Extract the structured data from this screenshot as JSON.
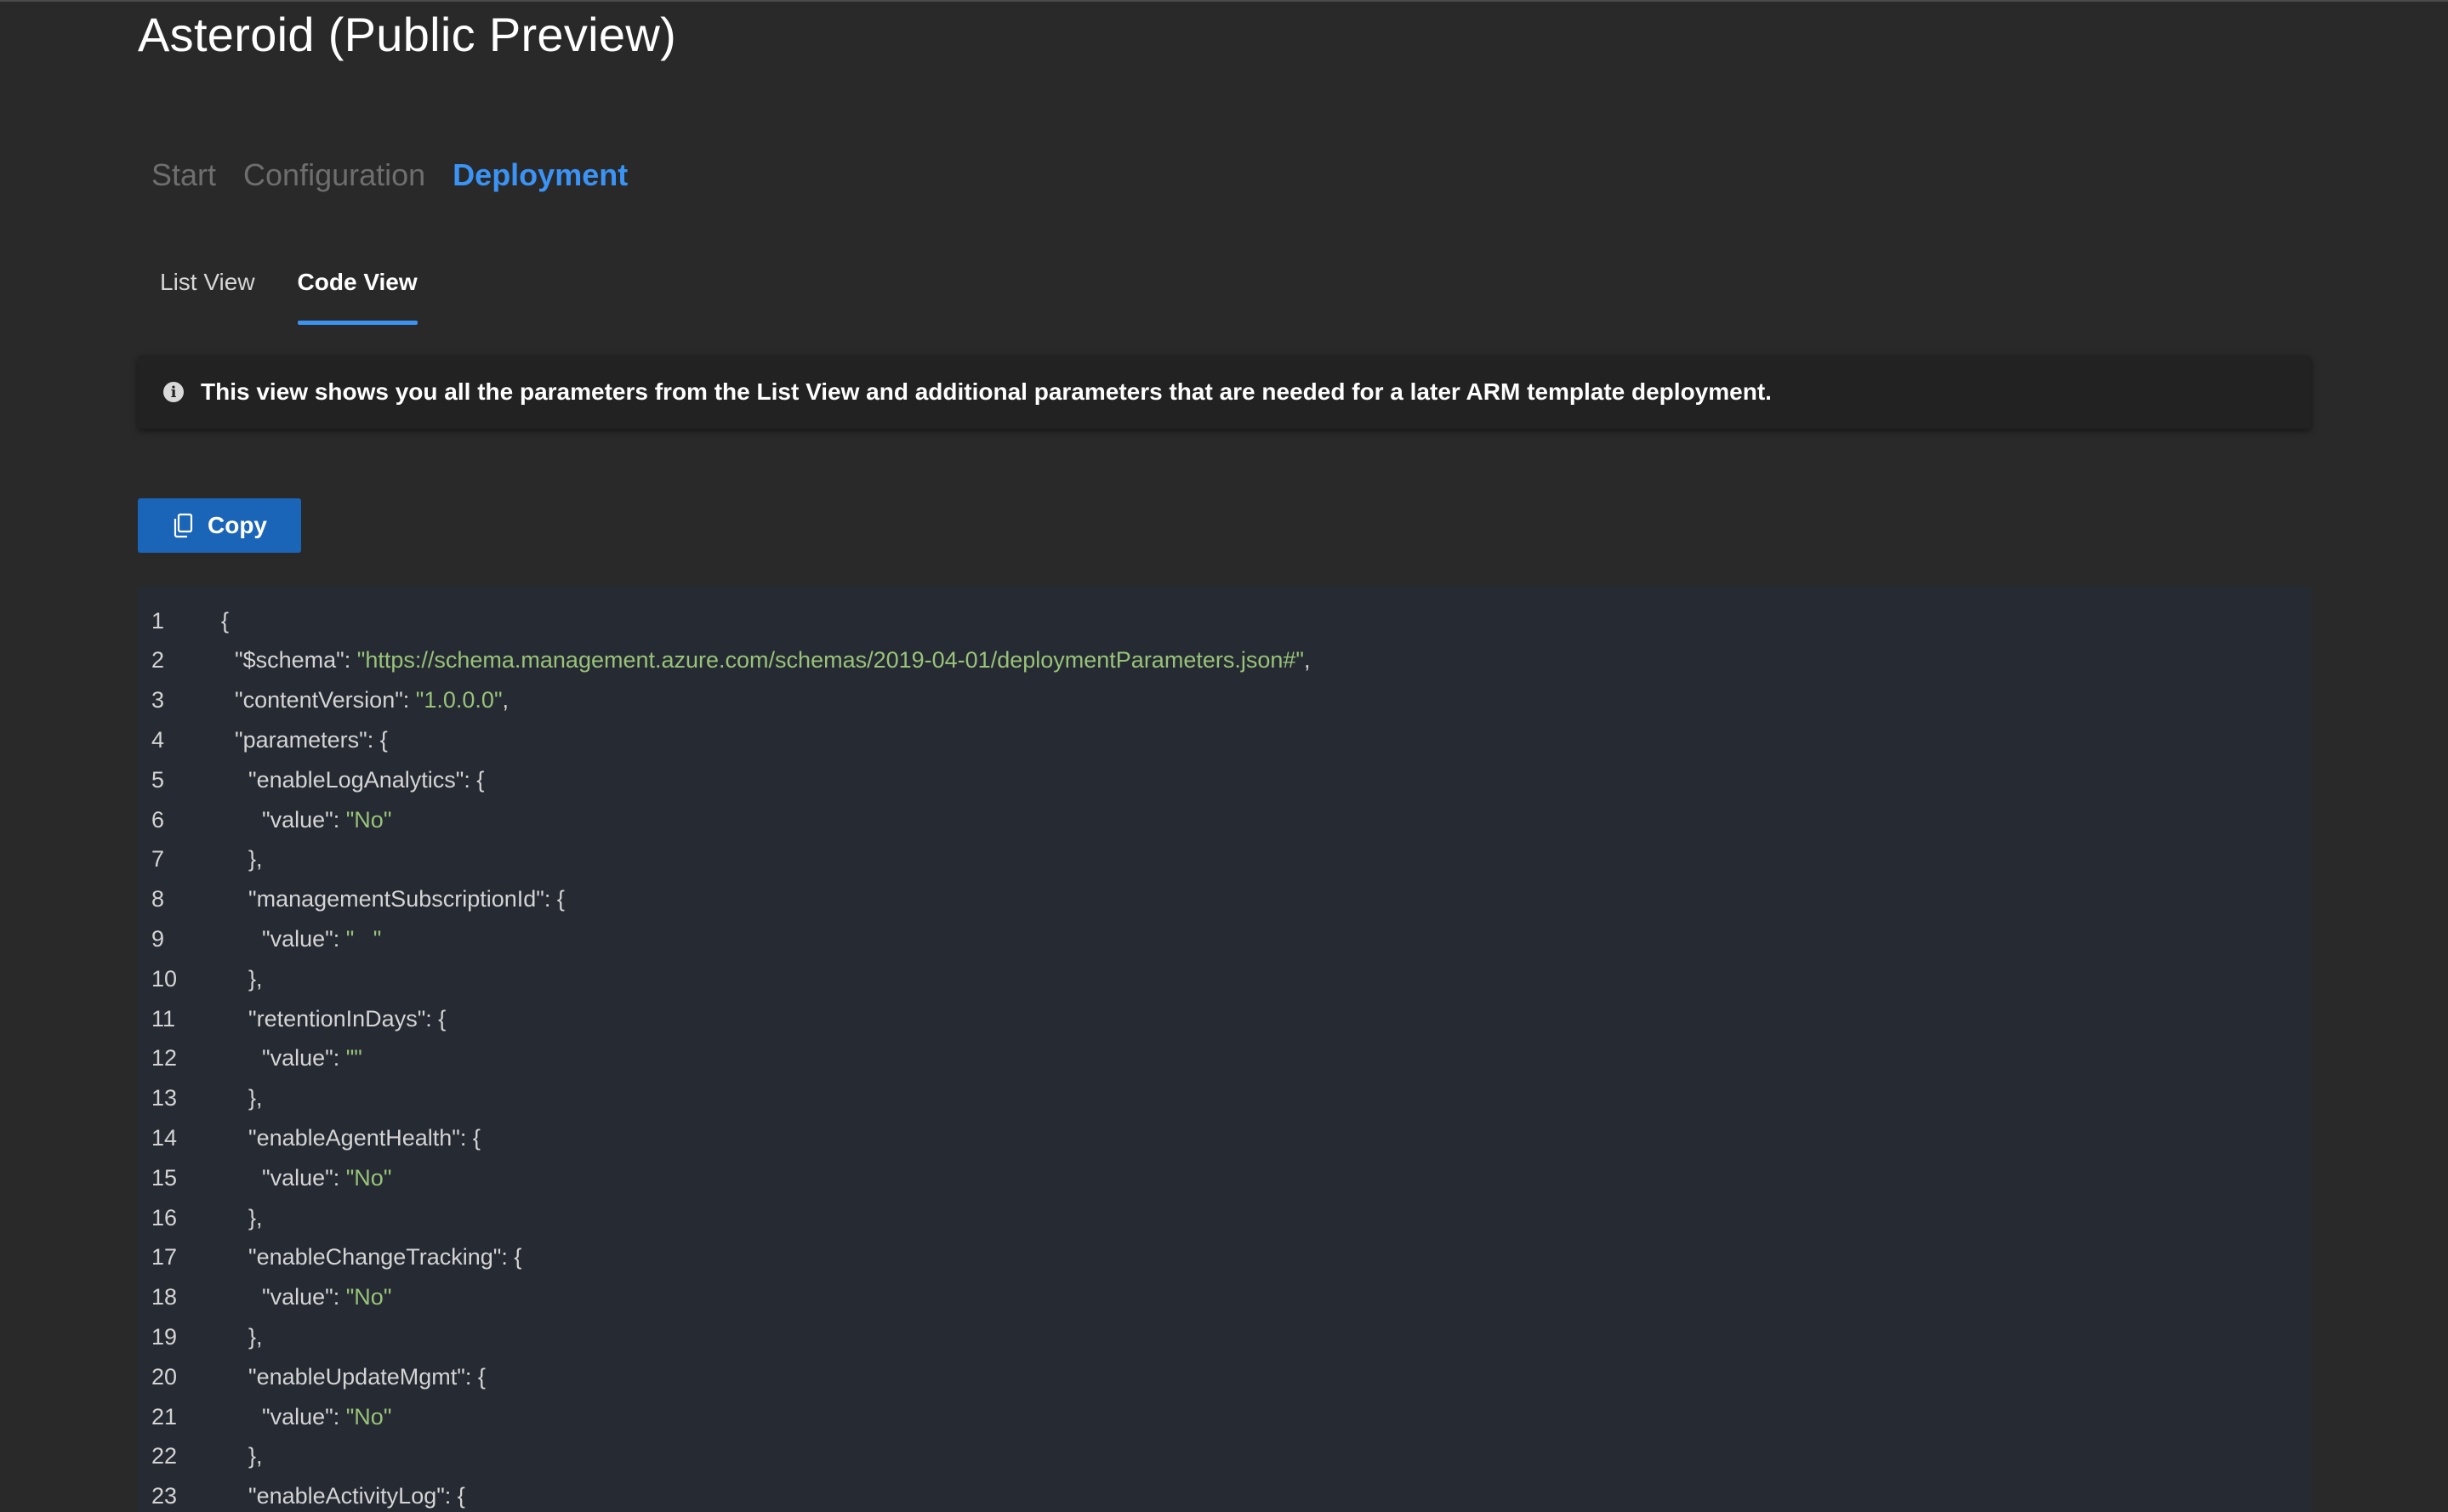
{
  "page": {
    "title": "Asteroid (Public Preview)"
  },
  "steps": [
    {
      "label": "Start",
      "active": false
    },
    {
      "label": "Configuration",
      "active": false
    },
    {
      "label": "Deployment",
      "active": true
    }
  ],
  "subtabs": [
    {
      "label": "List View",
      "active": false
    },
    {
      "label": "Code View",
      "active": true
    }
  ],
  "info": {
    "icon": "info-icon",
    "text": "This view shows you all the parameters from the List View and additional parameters that are needed for a later ARM template deployment."
  },
  "copy_button": {
    "label": "Copy",
    "icon": "copy-icon"
  },
  "colors": {
    "accent": "#3a93f5",
    "button": "#1a65b8",
    "string": "#98c379",
    "background": "#292929",
    "code_background": "#262a33"
  },
  "code_lines": [
    {
      "num": "1",
      "indent": 0,
      "pre": "{",
      "str": "",
      "post": ""
    },
    {
      "num": "2",
      "indent": 1,
      "pre": "\"$schema\": ",
      "str": "\"https://schema.management.azure.com/schemas/2019-04-01/deploymentParameters.json#\"",
      "post": ","
    },
    {
      "num": "3",
      "indent": 1,
      "pre": "\"contentVersion\": ",
      "str": "\"1.0.0.0\"",
      "post": ","
    },
    {
      "num": "4",
      "indent": 1,
      "pre": "\"parameters\": {",
      "str": "",
      "post": ""
    },
    {
      "num": "5",
      "indent": 2,
      "pre": "\"enableLogAnalytics\": {",
      "str": "",
      "post": ""
    },
    {
      "num": "6",
      "indent": 3,
      "pre": "\"value\": ",
      "str": "\"No\"",
      "post": ""
    },
    {
      "num": "7",
      "indent": 2,
      "pre": "},",
      "str": "",
      "post": ""
    },
    {
      "num": "8",
      "indent": 2,
      "pre": "\"managementSubscriptionId\": {",
      "str": "",
      "post": ""
    },
    {
      "num": "9",
      "indent": 3,
      "pre": "\"value\": ",
      "str": "\"   \"",
      "post": ""
    },
    {
      "num": "10",
      "indent": 2,
      "pre": "},",
      "str": "",
      "post": ""
    },
    {
      "num": "11",
      "indent": 2,
      "pre": "\"retentionInDays\": {",
      "str": "",
      "post": ""
    },
    {
      "num": "12",
      "indent": 3,
      "pre": "\"value\": ",
      "str": "\"\"",
      "post": ""
    },
    {
      "num": "13",
      "indent": 2,
      "pre": "},",
      "str": "",
      "post": ""
    },
    {
      "num": "14",
      "indent": 2,
      "pre": "\"enableAgentHealth\": {",
      "str": "",
      "post": ""
    },
    {
      "num": "15",
      "indent": 3,
      "pre": "\"value\": ",
      "str": "\"No\"",
      "post": ""
    },
    {
      "num": "16",
      "indent": 2,
      "pre": "},",
      "str": "",
      "post": ""
    },
    {
      "num": "17",
      "indent": 2,
      "pre": "\"enableChangeTracking\": {",
      "str": "",
      "post": ""
    },
    {
      "num": "18",
      "indent": 3,
      "pre": "\"value\": ",
      "str": "\"No\"",
      "post": ""
    },
    {
      "num": "19",
      "indent": 2,
      "pre": "},",
      "str": "",
      "post": ""
    },
    {
      "num": "20",
      "indent": 2,
      "pre": "\"enableUpdateMgmt\": {",
      "str": "",
      "post": ""
    },
    {
      "num": "21",
      "indent": 3,
      "pre": "\"value\": ",
      "str": "\"No\"",
      "post": ""
    },
    {
      "num": "22",
      "indent": 2,
      "pre": "},",
      "str": "",
      "post": ""
    },
    {
      "num": "23",
      "indent": 2,
      "pre": "\"enableActivityLog\": {",
      "str": "",
      "post": ""
    }
  ]
}
